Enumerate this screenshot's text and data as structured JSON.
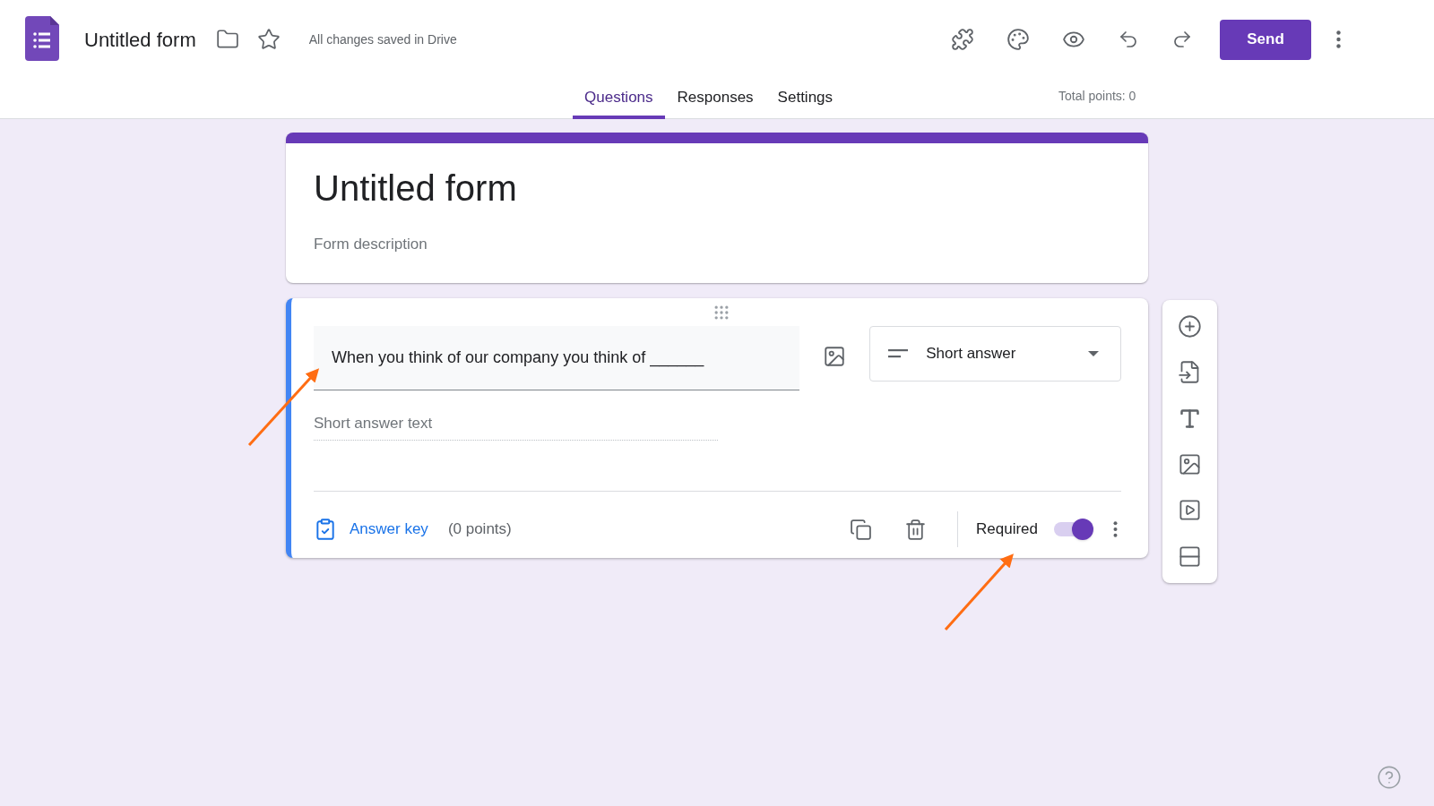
{
  "header": {
    "title": "Untitled form",
    "save_status": "All changes saved in Drive",
    "send_label": "Send"
  },
  "tabs": [
    {
      "label": "Questions",
      "selected": true
    },
    {
      "label": "Responses",
      "selected": false
    },
    {
      "label": "Settings",
      "selected": false
    }
  ],
  "total_points": "Total points: 0",
  "form": {
    "title": "Untitled form",
    "description_placeholder": "Form description"
  },
  "question": {
    "text": "When you think of our company you think of ______",
    "type": "Short answer",
    "answer_placeholder": "Short answer text",
    "answer_key": "Answer key",
    "points": "(0 points)",
    "required_label": "Required",
    "required": true
  }
}
